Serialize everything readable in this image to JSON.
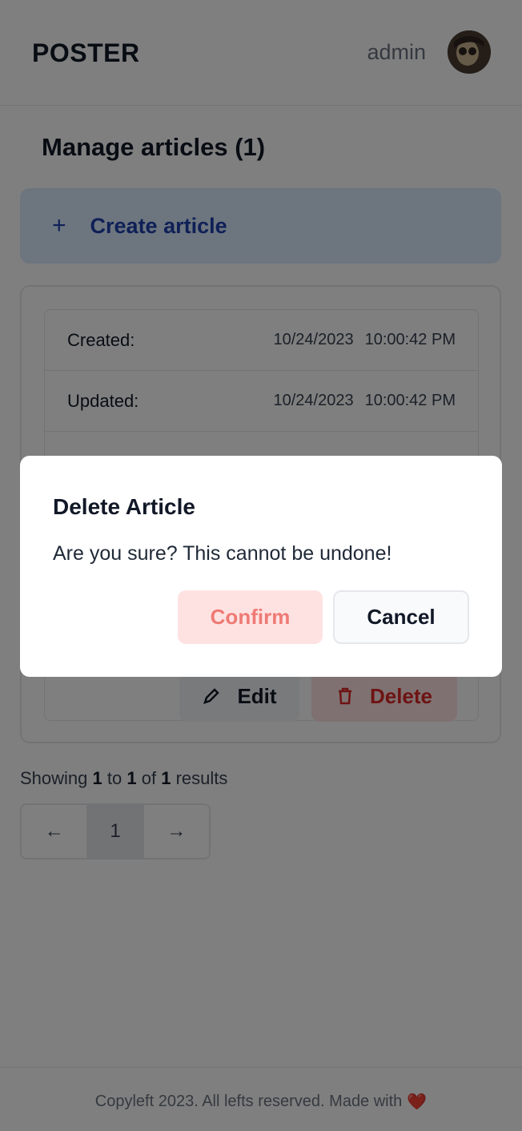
{
  "header": {
    "logo": "POSTER",
    "username": "admin"
  },
  "main": {
    "title": "Manage articles (1)",
    "create_button": {
      "icon": "+",
      "label": "Create article"
    },
    "article": {
      "rows": [
        {
          "label": "Created:",
          "date": "10/24/2023",
          "time": "10:00:42 PM"
        },
        {
          "label": "Updated:",
          "date": "10/24/2023",
          "time": "10:00:42 PM"
        }
      ],
      "edit_label": "Edit",
      "delete_label": "Delete"
    },
    "pagination": {
      "showing_prefix": "Showing",
      "from": "1",
      "to_word": "to",
      "to": "1",
      "of_word": "of",
      "total": "1",
      "results_word": "results",
      "prev_icon": "←",
      "current_page": "1",
      "next_icon": "→"
    }
  },
  "footer": {
    "text": "Copyleft 2023. All lefts reserved. Made with",
    "heart": "❤️"
  },
  "modal": {
    "title": "Delete Article",
    "body": "Are you sure? This cannot be undone!",
    "confirm_label": "Confirm",
    "cancel_label": "Cancel"
  }
}
